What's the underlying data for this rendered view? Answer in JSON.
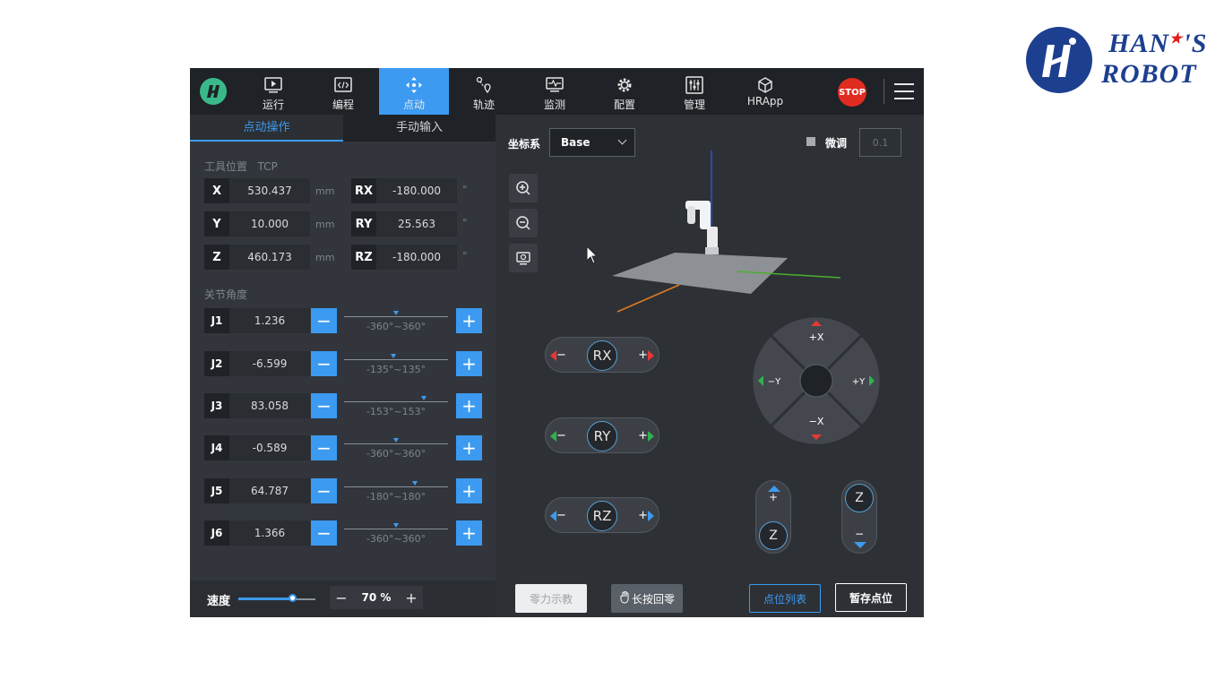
{
  "brand": {
    "line1": "HAN",
    "line2": "'S",
    "line3": "ROBOT",
    "star": "★"
  },
  "nav": {
    "items": [
      {
        "label": "运行",
        "icon": "play-icon"
      },
      {
        "label": "编程",
        "icon": "code-icon"
      },
      {
        "label": "点动",
        "icon": "move-icon"
      },
      {
        "label": "轨迹",
        "icon": "trajectory-icon"
      },
      {
        "label": "监测",
        "icon": "monitor-icon"
      },
      {
        "label": "配置",
        "icon": "gear-icon"
      },
      {
        "label": "管理",
        "icon": "sliders-icon"
      },
      {
        "label": "HRApp",
        "icon": "cube-icon"
      }
    ],
    "active_index": 2,
    "stop_label": "STOP"
  },
  "tabs": {
    "jog_operation": "点动操作",
    "manual_input": "手动输入"
  },
  "tool_position": {
    "title": "工具位置",
    "frame": "TCP",
    "unit_mm": "mm",
    "unit_deg": "°",
    "x": {
      "label": "X",
      "value": "530.437"
    },
    "y": {
      "label": "Y",
      "value": "10.000"
    },
    "z": {
      "label": "Z",
      "value": "460.173"
    },
    "rx": {
      "label": "RX",
      "value": "-180.000"
    },
    "ry": {
      "label": "RY",
      "value": "25.563"
    },
    "rz": {
      "label": "RZ",
      "value": "-180.000"
    }
  },
  "joints": {
    "title": "关节角度",
    "items": [
      {
        "label": "J1",
        "value": "1.236",
        "range": "-360°~360°",
        "level": 0.502
      },
      {
        "label": "J2",
        "value": "-6.599",
        "range": "-135°~135°",
        "level": 0.476
      },
      {
        "label": "J3",
        "value": "83.058",
        "range": "-153°~153°",
        "level": 0.771
      },
      {
        "label": "J4",
        "value": "-0.589",
        "range": "-360°~360°",
        "level": 0.499
      },
      {
        "label": "J5",
        "value": "64.787",
        "range": "-180°~180°",
        "level": 0.68
      },
      {
        "label": "J6",
        "value": "1.366",
        "range": "-360°~360°",
        "level": 0.502
      }
    ]
  },
  "speed": {
    "label": "速度",
    "value": "70 %",
    "level": 0.7,
    "minus": "−",
    "plus": "+"
  },
  "coord": {
    "label": "坐标系",
    "selected": "Base"
  },
  "fine": {
    "label": "微调",
    "value": "0.1"
  },
  "rot_pills": [
    {
      "name": "RX",
      "minus": "−",
      "plus": "+",
      "color": "#e53935"
    },
    {
      "name": "RY",
      "minus": "−",
      "plus": "+",
      "color": "#2eb24f"
    },
    {
      "name": "RZ",
      "minus": "−",
      "plus": "+",
      "color": "#3c9af0"
    }
  ],
  "dpad": {
    "up": "+X",
    "down": "−X",
    "left": "−Y",
    "right": "+Y"
  },
  "zjog": {
    "up_sign": "+",
    "down_sign": "−",
    "label": "Z"
  },
  "buttons": {
    "free_drive": "零力示教",
    "long_press_home": "长按回零",
    "point_list": "点位列表",
    "save_point": "暂存点位"
  },
  "colors": {
    "accent": "#3c9af0",
    "stop": "#e02b20",
    "bg": "#2a2e33"
  }
}
